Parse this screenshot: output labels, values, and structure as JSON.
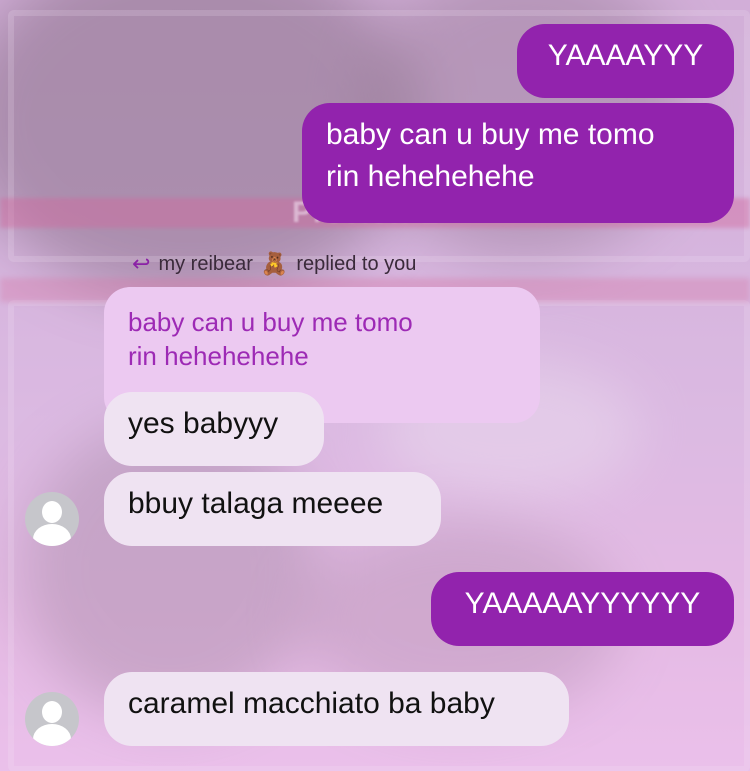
{
  "reply_header": {
    "sender": "my reibear",
    "sender_emoji": "🧸",
    "text": "replied to you"
  },
  "messages": [
    {
      "direction": "sent",
      "text": "YAAAAYYY"
    },
    {
      "direction": "sent",
      "line1": "baby can u buy me tomo",
      "line2": "rin hehehehehe"
    },
    {
      "direction": "quoted_reply",
      "line1": "baby can u buy me tomo",
      "line2": "rin hehehehehe"
    },
    {
      "direction": "received",
      "text": "yes babyyy"
    },
    {
      "direction": "received",
      "text": "bbuy talaga meeee"
    },
    {
      "direction": "sent",
      "text": "YAAAAAYYYYYY"
    },
    {
      "direction": "received",
      "text": "caramel macchiato ba baby"
    }
  ],
  "background_text": "Preview 2",
  "colors": {
    "sent_bubble": "#9223ad",
    "received_bubble": "#efe3f2",
    "quoted_bubble": "#ecc9f1",
    "quoted_text": "#9d2ab5"
  }
}
